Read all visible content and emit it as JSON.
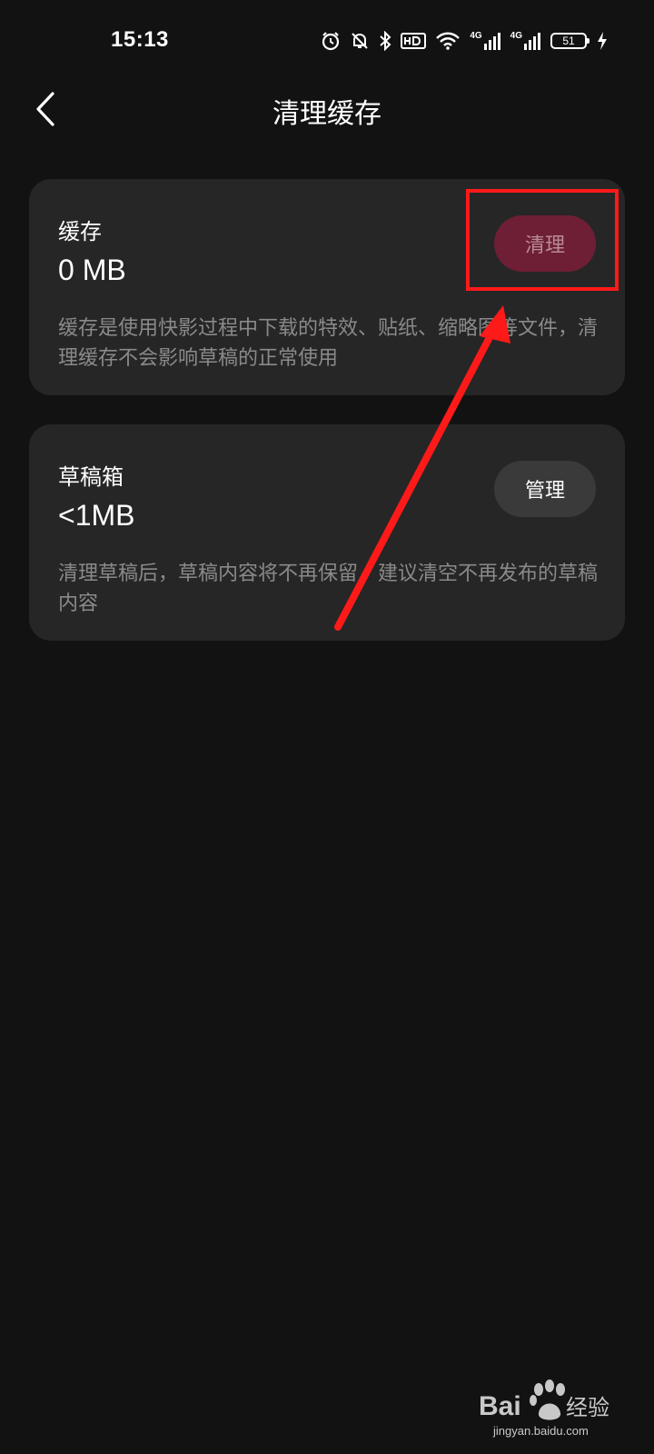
{
  "status_bar": {
    "time": "15:13",
    "network_1": "4G",
    "network_2": "4G",
    "battery_level": "51",
    "icons": [
      "alarm-icon",
      "bell-muted-icon",
      "bluetooth-icon",
      "hd-voice-icon",
      "wifi-icon",
      "signal-icon",
      "signal-icon",
      "battery-icon",
      "charging-icon"
    ]
  },
  "header": {
    "title": "清理缓存",
    "back_icon": "chevron-left-icon"
  },
  "cache_card": {
    "title": "缓存",
    "size": "0 MB",
    "description": "缓存是使用快影过程中下载的特效、贴纸、缩略图等文件，清理缓存不会影响草稿的正常使用",
    "button_label": "清理"
  },
  "drafts_card": {
    "title": "草稿箱",
    "size": "<1MB",
    "description": "清理草稿后，草稿内容将不再保留，建议清空不再发布的草稿内容",
    "button_label": "管理"
  },
  "annotation": {
    "color": "#ff1a1a"
  },
  "colors": {
    "background": "#121212",
    "card": "#262626",
    "clear_button": "#6e1f35",
    "manage_button": "#3a3a3a",
    "muted_text": "#8a8a8a"
  }
}
